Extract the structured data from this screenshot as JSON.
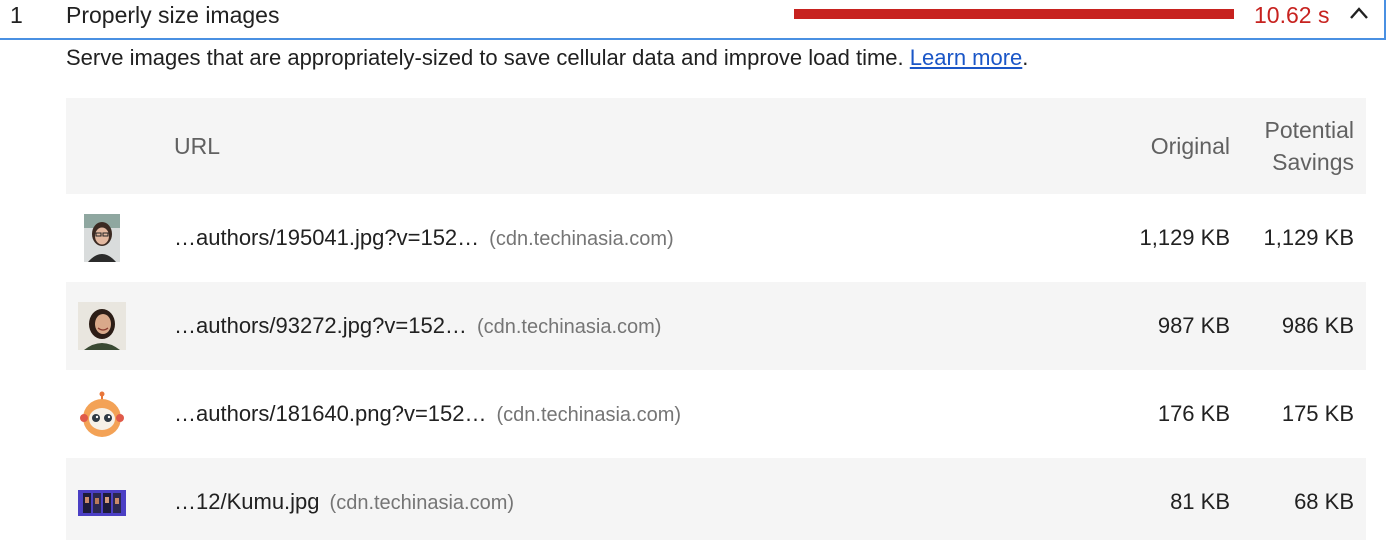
{
  "audit": {
    "index": "1",
    "title": "Properly size images",
    "savings": "10.62 s",
    "savings_fraction": 1.0,
    "description": "Serve images that are appropriately-sized to save cellular data and improve load time.",
    "learn_more": "Learn more",
    "description_end": ".",
    "bar_color": "#c7221f",
    "expanded": true
  },
  "table": {
    "headers": {
      "url": "URL",
      "original": "Original",
      "savings_line1": "Potential",
      "savings_line2": "Savings"
    },
    "rows": [
      {
        "url": "…authors/195041.jpg?v=152…",
        "host": "(cdn.techinasia.com)",
        "original": "1,129 KB",
        "savings": "1,129 KB",
        "thumb": "portrait-woman-glasses"
      },
      {
        "url": "…authors/93272.jpg?v=152…",
        "host": "(cdn.techinasia.com)",
        "original": "987 KB",
        "savings": "986 KB",
        "thumb": "portrait-woman-smiling"
      },
      {
        "url": "…authors/181640.png?v=152…",
        "host": "(cdn.techinasia.com)",
        "original": "176 KB",
        "savings": "175 KB",
        "thumb": "robot-mascot"
      },
      {
        "url": "…12/Kumu.jpg",
        "host": "(cdn.techinasia.com)",
        "original": "81 KB",
        "savings": "68 KB",
        "thumb": "kumu-app-screens"
      }
    ]
  }
}
